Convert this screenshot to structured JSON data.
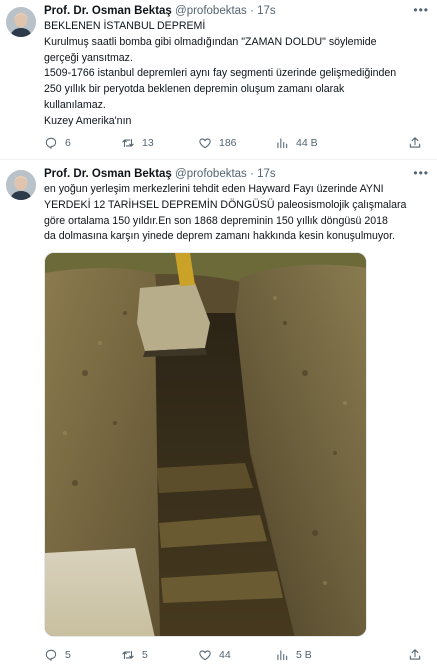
{
  "tweets": [
    {
      "author": {
        "name": "Prof. Dr. Osman Bektaş",
        "handle": "@profobektas",
        "time": "17s"
      },
      "lines": [
        "BEKLENEN İSTANBUL DEPREMİ",
        "Kurulmuş saatli bomba gibi olmadığından \"ZAMAN DOLDU\" söylemide",
        "gerçeği yansıtmaz.",
        "1509-1766 istanbul depremleri aynı fay segmenti üzerinde gelişmediğinden",
        "250 yıllık bir peryotda beklenen depremin oluşum zamanı olarak",
        "kullanılamaz.",
        "Kuzey Amerika'nın"
      ],
      "stats": {
        "replies": "6",
        "retweets": "13",
        "likes": "186",
        "views": "44 B"
      }
    },
    {
      "author": {
        "name": "Prof. Dr. Osman Bektaş",
        "handle": "@profobektas",
        "time": "17s"
      },
      "lines": [
        "en yoğun yerleşim merkezlerini tehdit eden Hayward Fayı üzerinde AYNI",
        "YERDEKİ 12 TARİHSEL DEPREMİN DÖNGÜSÜ paleosismolojik çalışmalara",
        "göre ortalama 150 yıldır.En son 1868 depreminin  150 yıllık döngüsü 2018",
        "da dolmasına  karşın yinede deprem zamanı hakkında kesin konuşulmuyor."
      ],
      "stats": {
        "replies": "5",
        "retweets": "5",
        "likes": "44",
        "views": "5 B"
      }
    }
  ],
  "colors": {
    "text": "#0f1419",
    "muted": "#536471",
    "divider": "#eff3f4"
  },
  "icons": [
    "more-icon",
    "reply-icon",
    "retweet-icon",
    "like-icon",
    "views-icon",
    "share-icon"
  ]
}
